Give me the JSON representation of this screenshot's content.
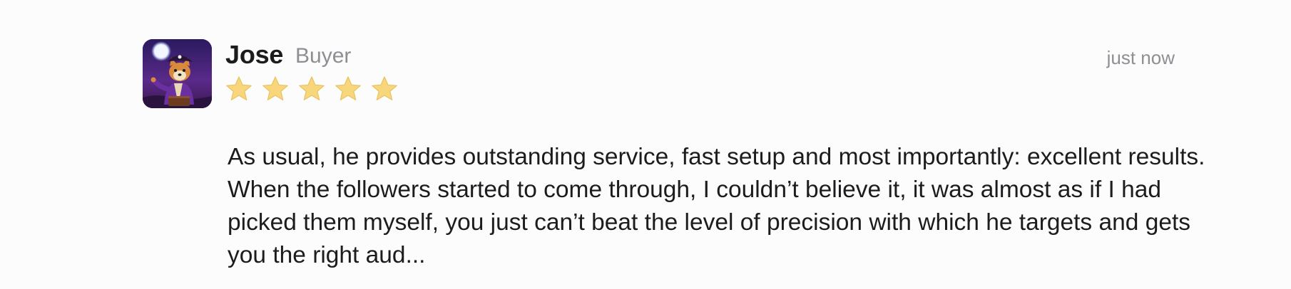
{
  "review": {
    "author": "Jose",
    "role": "Buyer",
    "timestamp": "just now",
    "rating": 5,
    "max_rating": 5,
    "text": "As usual, he provides outstanding service, fast setup and most importantly: excellent results. When the followers started to come through, I couldn’t believe it, it was almost as if I had picked them myself, you just can’t beat the level of precision with which he targets and gets you the right aud...",
    "avatar_icon": "shiba-pirate-avatar",
    "star_icon": "star-icon"
  },
  "colors": {
    "star_fill": "#f7d67c",
    "star_stroke": "#e9c25f",
    "text": "#1c1c1e",
    "muted": "#8e8e93",
    "background": "#fcfcfd",
    "avatar_bg": "#3d1e6b"
  }
}
